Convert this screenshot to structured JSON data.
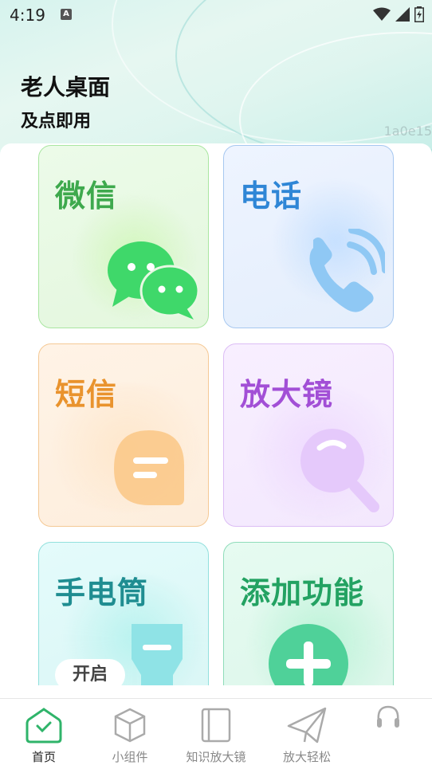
{
  "status_bar": {
    "time": "4:19",
    "notification_icon": "A"
  },
  "header": {
    "title": "老人桌面",
    "subtitle": "及点即用",
    "watermark": "1a0e15"
  },
  "cards": {
    "wechat": {
      "label": "微信",
      "icon": "wechat-icon",
      "color": "#3ea94d"
    },
    "phone": {
      "label": "电话",
      "icon": "phone-icon",
      "color": "#2f86d6"
    },
    "sms": {
      "label": "短信",
      "icon": "message-icon",
      "color": "#e9932d"
    },
    "magnifier": {
      "label": "放大镜",
      "icon": "magnifier-icon",
      "color": "#a24fd6"
    },
    "flashlight": {
      "label": "手电筒",
      "icon": "flashlight-icon",
      "color": "#1f8d91",
      "button_label": "开启"
    },
    "add": {
      "label": "添加功能",
      "icon": "plus-icon",
      "color": "#23a262"
    }
  },
  "bottom_nav": {
    "items": [
      {
        "label": "首页",
        "icon": "home-icon",
        "active": true
      },
      {
        "label": "小组件",
        "icon": "cube-icon",
        "active": false
      },
      {
        "label": "知识放大镜",
        "icon": "book-icon",
        "active": false
      },
      {
        "label": "放大轻松",
        "icon": "paper-plane-icon",
        "active": false
      },
      {
        "label": "",
        "icon": "headset-icon",
        "active": false
      }
    ]
  }
}
